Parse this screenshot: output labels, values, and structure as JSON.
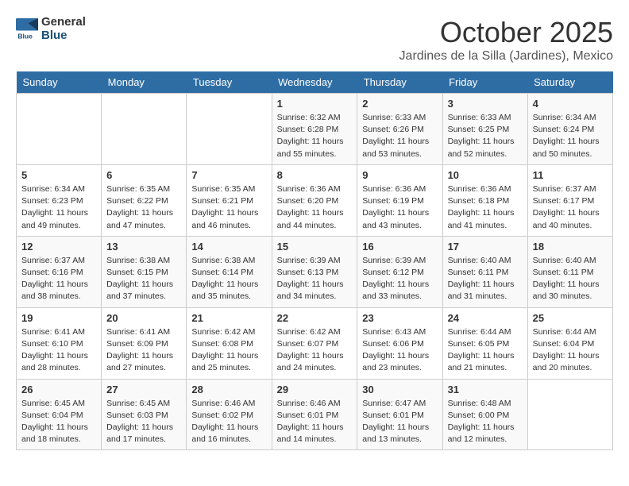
{
  "header": {
    "logo_general": "General",
    "logo_blue": "Blue",
    "month": "October 2025",
    "location": "Jardines de la Silla (Jardines), Mexico"
  },
  "weekdays": [
    "Sunday",
    "Monday",
    "Tuesday",
    "Wednesday",
    "Thursday",
    "Friday",
    "Saturday"
  ],
  "weeks": [
    [
      {
        "day": "",
        "info": ""
      },
      {
        "day": "",
        "info": ""
      },
      {
        "day": "",
        "info": ""
      },
      {
        "day": "1",
        "sunrise": "Sunrise: 6:32 AM",
        "sunset": "Sunset: 6:28 PM",
        "daylight": "Daylight: 11 hours and 55 minutes."
      },
      {
        "day": "2",
        "sunrise": "Sunrise: 6:33 AM",
        "sunset": "Sunset: 6:26 PM",
        "daylight": "Daylight: 11 hours and 53 minutes."
      },
      {
        "day": "3",
        "sunrise": "Sunrise: 6:33 AM",
        "sunset": "Sunset: 6:25 PM",
        "daylight": "Daylight: 11 hours and 52 minutes."
      },
      {
        "day": "4",
        "sunrise": "Sunrise: 6:34 AM",
        "sunset": "Sunset: 6:24 PM",
        "daylight": "Daylight: 11 hours and 50 minutes."
      }
    ],
    [
      {
        "day": "5",
        "sunrise": "Sunrise: 6:34 AM",
        "sunset": "Sunset: 6:23 PM",
        "daylight": "Daylight: 11 hours and 49 minutes."
      },
      {
        "day": "6",
        "sunrise": "Sunrise: 6:35 AM",
        "sunset": "Sunset: 6:22 PM",
        "daylight": "Daylight: 11 hours and 47 minutes."
      },
      {
        "day": "7",
        "sunrise": "Sunrise: 6:35 AM",
        "sunset": "Sunset: 6:21 PM",
        "daylight": "Daylight: 11 hours and 46 minutes."
      },
      {
        "day": "8",
        "sunrise": "Sunrise: 6:36 AM",
        "sunset": "Sunset: 6:20 PM",
        "daylight": "Daylight: 11 hours and 44 minutes."
      },
      {
        "day": "9",
        "sunrise": "Sunrise: 6:36 AM",
        "sunset": "Sunset: 6:19 PM",
        "daylight": "Daylight: 11 hours and 43 minutes."
      },
      {
        "day": "10",
        "sunrise": "Sunrise: 6:36 AM",
        "sunset": "Sunset: 6:18 PM",
        "daylight": "Daylight: 11 hours and 41 minutes."
      },
      {
        "day": "11",
        "sunrise": "Sunrise: 6:37 AM",
        "sunset": "Sunset: 6:17 PM",
        "daylight": "Daylight: 11 hours and 40 minutes."
      }
    ],
    [
      {
        "day": "12",
        "sunrise": "Sunrise: 6:37 AM",
        "sunset": "Sunset: 6:16 PM",
        "daylight": "Daylight: 11 hours and 38 minutes."
      },
      {
        "day": "13",
        "sunrise": "Sunrise: 6:38 AM",
        "sunset": "Sunset: 6:15 PM",
        "daylight": "Daylight: 11 hours and 37 minutes."
      },
      {
        "day": "14",
        "sunrise": "Sunrise: 6:38 AM",
        "sunset": "Sunset: 6:14 PM",
        "daylight": "Daylight: 11 hours and 35 minutes."
      },
      {
        "day": "15",
        "sunrise": "Sunrise: 6:39 AM",
        "sunset": "Sunset: 6:13 PM",
        "daylight": "Daylight: 11 hours and 34 minutes."
      },
      {
        "day": "16",
        "sunrise": "Sunrise: 6:39 AM",
        "sunset": "Sunset: 6:12 PM",
        "daylight": "Daylight: 11 hours and 33 minutes."
      },
      {
        "day": "17",
        "sunrise": "Sunrise: 6:40 AM",
        "sunset": "Sunset: 6:11 PM",
        "daylight": "Daylight: 11 hours and 31 minutes."
      },
      {
        "day": "18",
        "sunrise": "Sunrise: 6:40 AM",
        "sunset": "Sunset: 6:11 PM",
        "daylight": "Daylight: 11 hours and 30 minutes."
      }
    ],
    [
      {
        "day": "19",
        "sunrise": "Sunrise: 6:41 AM",
        "sunset": "Sunset: 6:10 PM",
        "daylight": "Daylight: 11 hours and 28 minutes."
      },
      {
        "day": "20",
        "sunrise": "Sunrise: 6:41 AM",
        "sunset": "Sunset: 6:09 PM",
        "daylight": "Daylight: 11 hours and 27 minutes."
      },
      {
        "day": "21",
        "sunrise": "Sunrise: 6:42 AM",
        "sunset": "Sunset: 6:08 PM",
        "daylight": "Daylight: 11 hours and 25 minutes."
      },
      {
        "day": "22",
        "sunrise": "Sunrise: 6:42 AM",
        "sunset": "Sunset: 6:07 PM",
        "daylight": "Daylight: 11 hours and 24 minutes."
      },
      {
        "day": "23",
        "sunrise": "Sunrise: 6:43 AM",
        "sunset": "Sunset: 6:06 PM",
        "daylight": "Daylight: 11 hours and 23 minutes."
      },
      {
        "day": "24",
        "sunrise": "Sunrise: 6:44 AM",
        "sunset": "Sunset: 6:05 PM",
        "daylight": "Daylight: 11 hours and 21 minutes."
      },
      {
        "day": "25",
        "sunrise": "Sunrise: 6:44 AM",
        "sunset": "Sunset: 6:04 PM",
        "daylight": "Daylight: 11 hours and 20 minutes."
      }
    ],
    [
      {
        "day": "26",
        "sunrise": "Sunrise: 6:45 AM",
        "sunset": "Sunset: 6:04 PM",
        "daylight": "Daylight: 11 hours and 18 minutes."
      },
      {
        "day": "27",
        "sunrise": "Sunrise: 6:45 AM",
        "sunset": "Sunset: 6:03 PM",
        "daylight": "Daylight: 11 hours and 17 minutes."
      },
      {
        "day": "28",
        "sunrise": "Sunrise: 6:46 AM",
        "sunset": "Sunset: 6:02 PM",
        "daylight": "Daylight: 11 hours and 16 minutes."
      },
      {
        "day": "29",
        "sunrise": "Sunrise: 6:46 AM",
        "sunset": "Sunset: 6:01 PM",
        "daylight": "Daylight: 11 hours and 14 minutes."
      },
      {
        "day": "30",
        "sunrise": "Sunrise: 6:47 AM",
        "sunset": "Sunset: 6:01 PM",
        "daylight": "Daylight: 11 hours and 13 minutes."
      },
      {
        "day": "31",
        "sunrise": "Sunrise: 6:48 AM",
        "sunset": "Sunset: 6:00 PM",
        "daylight": "Daylight: 11 hours and 12 minutes."
      },
      {
        "day": "",
        "info": ""
      }
    ]
  ]
}
